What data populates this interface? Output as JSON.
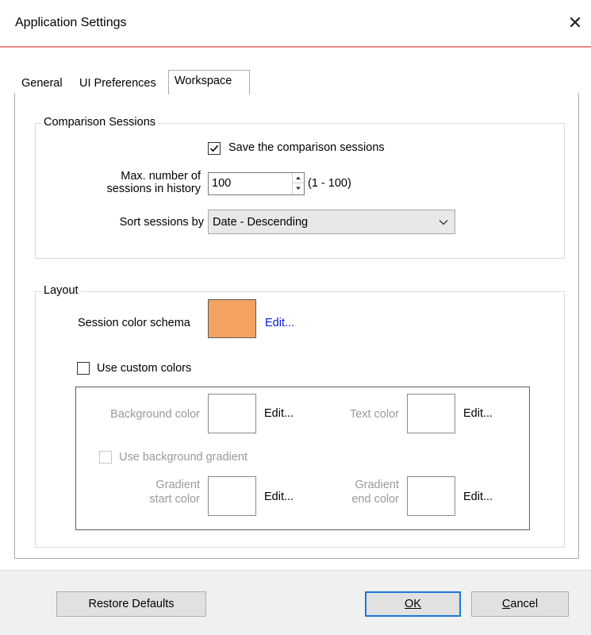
{
  "window": {
    "title": "Application Settings"
  },
  "tabs": [
    {
      "label": "General",
      "active": false
    },
    {
      "label": "UI Preferences",
      "active": false
    },
    {
      "label": "Workspace",
      "active": true
    }
  ],
  "comparison_sessions": {
    "legend": "Comparison Sessions",
    "save_label": "Save the comparison sessions",
    "save_checked": true,
    "max_label_line1": "Max. number of",
    "max_label_line2": "sessions in history",
    "max_value": "100",
    "range_text": "(1 - 100)",
    "sort_label": "Sort sessions by",
    "sort_value": "Date - Descending"
  },
  "layout": {
    "legend": "Layout",
    "schema_label": "Session color schema",
    "schema_color": "#f4a261",
    "edit_label": "Edit...",
    "custom_label": "Use custom colors",
    "custom_checked": false,
    "custom": {
      "background_label": "Background color",
      "text_color_label": "Text color",
      "gradient_label": "Use background gradient",
      "grad_start_line1": "Gradient",
      "grad_start_line2": "start color",
      "grad_end_line1": "Gradient",
      "grad_end_line2": "end color",
      "edit_label": "Edit..."
    }
  },
  "buttons": {
    "restore": "Restore Defaults",
    "ok": "OK",
    "cancel": "Cancel"
  }
}
